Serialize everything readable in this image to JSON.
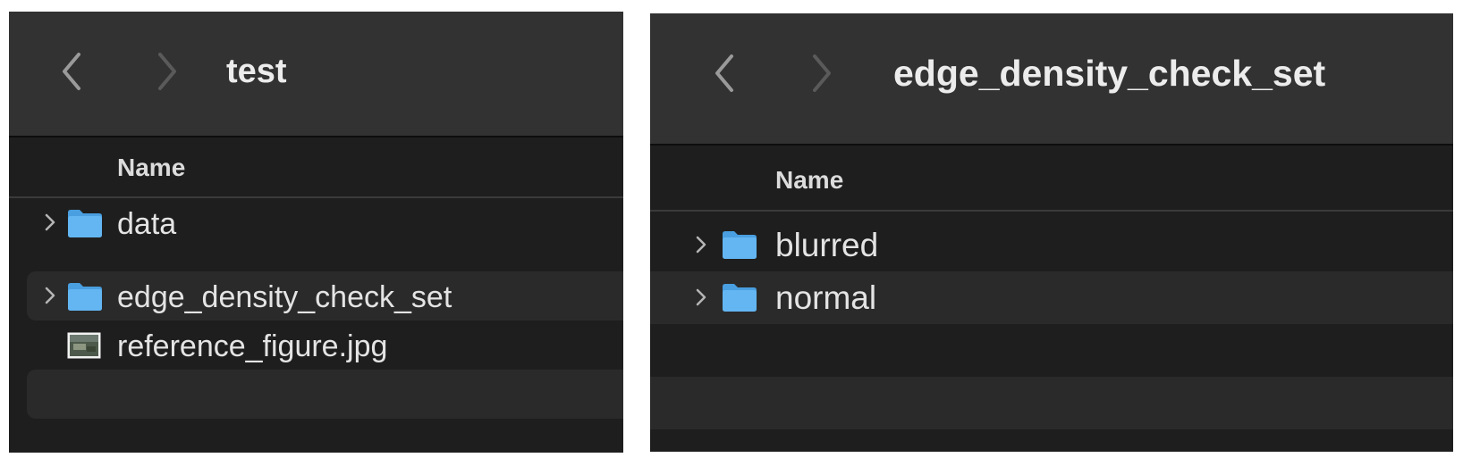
{
  "left_window": {
    "title": "test",
    "column_header": "Name",
    "items": [
      {
        "label": "data",
        "kind": "folder",
        "expandable": true
      },
      {
        "label": "edge_density_check_set",
        "kind": "folder",
        "expandable": true
      },
      {
        "label": "reference_figure.jpg",
        "kind": "image-file",
        "expandable": false
      }
    ]
  },
  "right_window": {
    "title": "edge_density_check_set",
    "column_header": "Name",
    "items": [
      {
        "label": "blurred",
        "kind": "folder",
        "expandable": true
      },
      {
        "label": "normal",
        "kind": "folder",
        "expandable": true
      }
    ]
  },
  "colors": {
    "toolbar": "#323232",
    "list_background": "#1e1e1e",
    "alternate_row": "#2a2a2a",
    "folder_blue": "#5fb3f0",
    "text": "#e4e4e4"
  },
  "icons": {
    "back": "chevron-left-icon",
    "forward": "chevron-right-icon",
    "disclosure": "disclosure-triangle-icon",
    "folder": "folder-icon",
    "image_file": "image-file-icon"
  }
}
